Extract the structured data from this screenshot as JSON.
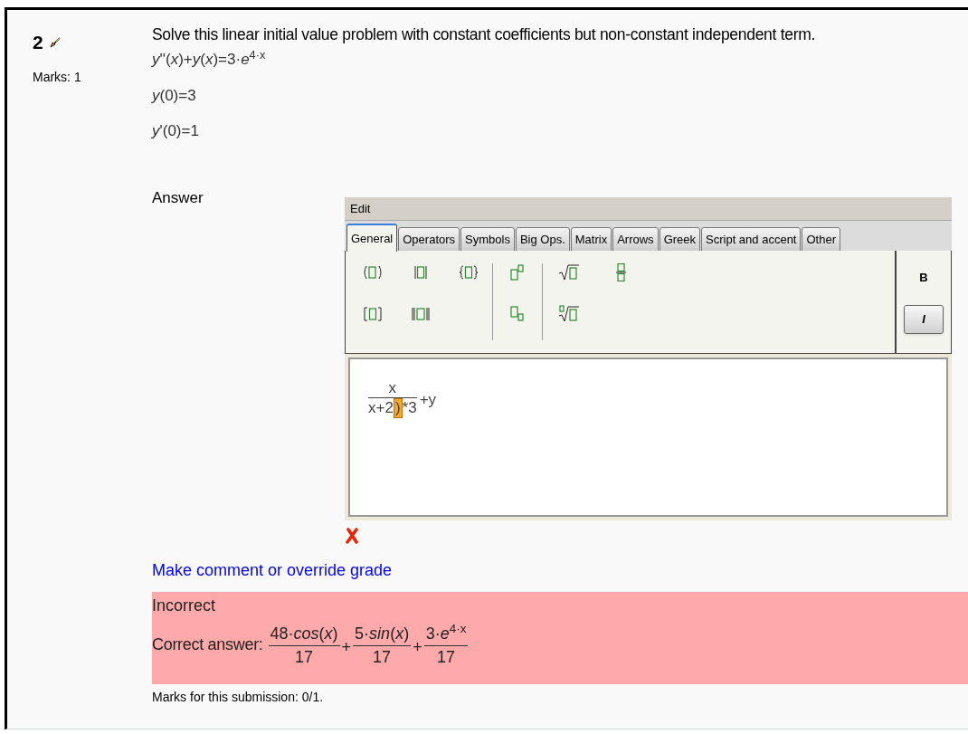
{
  "question": {
    "number": "2",
    "marks": "Marks: 1",
    "text": "Solve this linear initial value problem with constant coefficients but non-constant independent term.",
    "equations": [
      "*y*''(*x*)+*y*(*x*)=3·*e*$^{4·x}$",
      "*y*(0)=3",
      "*y*'(0)=1"
    ]
  },
  "answer_label": "Answer",
  "editor": {
    "menu": [
      "Edit"
    ],
    "tabs": [
      {
        "label": "General",
        "selected": true
      },
      {
        "label": "Operators",
        "selected": false
      },
      {
        "label": "Symbols",
        "selected": false
      },
      {
        "label": "Big Ops.",
        "selected": false
      },
      {
        "label": "Matrix",
        "selected": false
      },
      {
        "label": "Arrows",
        "selected": false
      },
      {
        "label": "Greek",
        "selected": false
      },
      {
        "label": "Script and accent",
        "selected": false
      },
      {
        "label": "Other",
        "selected": false
      }
    ],
    "format_buttons": [
      {
        "label": "B",
        "selected": false
      },
      {
        "label": "I",
        "selected": true
      }
    ],
    "content": {
      "numerator": "x",
      "denominator_before": "x+2",
      "cursor_char": ")",
      "denominator_after": "*3",
      "after": "+y"
    }
  },
  "result_mark": {
    "correct": false
  },
  "comment_link": "Make comment or override grade",
  "feedback": {
    "status": "Incorrect",
    "correct_label": "Correct answer:",
    "terms": [
      {
        "numerator": "48·*cos*(*x*)",
        "denominator": "17"
      },
      {
        "sign": "+",
        "numerator": "5·*sin*(*x*)",
        "denominator": "17"
      },
      {
        "sign": "+",
        "numerator": "3·*e*$^{4·x}$",
        "denominator": "17"
      }
    ]
  },
  "marks_submission": "Marks for this submission: 0/1."
}
